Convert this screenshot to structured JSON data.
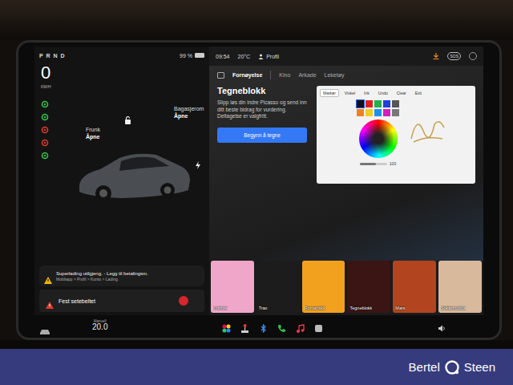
{
  "left": {
    "gear": "P R N D",
    "battery": "99 %",
    "speed": "0",
    "speed_unit": "KM/H",
    "indicators": [
      {
        "color": "#35c24a"
      },
      {
        "color": "#35c24a"
      },
      {
        "color": "#e03a2f"
      },
      {
        "color": "#e03a2f"
      },
      {
        "color": "#35c24a"
      }
    ],
    "car": {
      "frunk_label": "Frunk",
      "frunk_state": "Åpne",
      "trunk_label": "Bagasjerom",
      "trunk_state": "Åpne"
    },
    "alert": {
      "title": "Superlading utilgjeng. - Legg til betalingsm.",
      "path": "Mobilapp > Profil > Konto > Lading"
    },
    "seatbelt": "Fest setebeltet"
  },
  "status_bar": {
    "time": "09:54",
    "temp": "20°C",
    "profile": "Profil",
    "sos": "SOS"
  },
  "tabs": [
    {
      "label": "Fornøyelse",
      "selected": true
    },
    {
      "label": "Kino",
      "selected": false
    },
    {
      "label": "Arkade",
      "selected": false
    },
    {
      "label": "Leketøy",
      "selected": false
    }
  ],
  "feature": {
    "title": "Tegneblokk",
    "description": "Slipp løs din indre Picasso og send inn ditt beste bidrag for vurdering. Deltagelse er valgfritt.",
    "button": "Begynn å tegne"
  },
  "preview": {
    "tools": [
      {
        "label": "Markør",
        "selected": true
      },
      {
        "label": "Viskel",
        "selected": false
      },
      {
        "label": "Ink",
        "selected": false
      },
      {
        "label": "Undo",
        "selected": false
      },
      {
        "label": "Clear",
        "selected": false
      },
      {
        "label": "Exit",
        "selected": false
      }
    ],
    "swatches": [
      {
        "color": "#111111",
        "selected": true
      },
      {
        "color": "#e02020",
        "selected": false
      },
      {
        "color": "#22b14c",
        "selected": false
      },
      {
        "color": "#2040e0",
        "selected": false
      },
      {
        "color": "#555555",
        "selected": false
      },
      {
        "color": "#f08020",
        "selected": false
      },
      {
        "color": "#f0d020",
        "selected": false
      },
      {
        "color": "#2090f0",
        "selected": false
      },
      {
        "color": "#d020c0",
        "selected": false
      },
      {
        "color": "#777777",
        "selected": false
      }
    ],
    "size": "100",
    "size_level": 0.6
  },
  "tiles": [
    {
      "label": "Lyshow",
      "color": "#f0a6c8"
    },
    {
      "label": "Trax",
      "color": "#1c1c1c"
    },
    {
      "label": "Romantikk",
      "color": "#f2a11e"
    },
    {
      "label": "Tegneblokk",
      "color": "#3b1414"
    },
    {
      "label": "Mars",
      "color": "#b2451f"
    },
    {
      "label": "Sjåførmodus",
      "color": "#d9b99b"
    }
  ],
  "dock": {
    "mode": "Manuell",
    "temp": "20.0"
  },
  "footer": {
    "brand_left": "Bertel",
    "brand_right": "Steen"
  }
}
